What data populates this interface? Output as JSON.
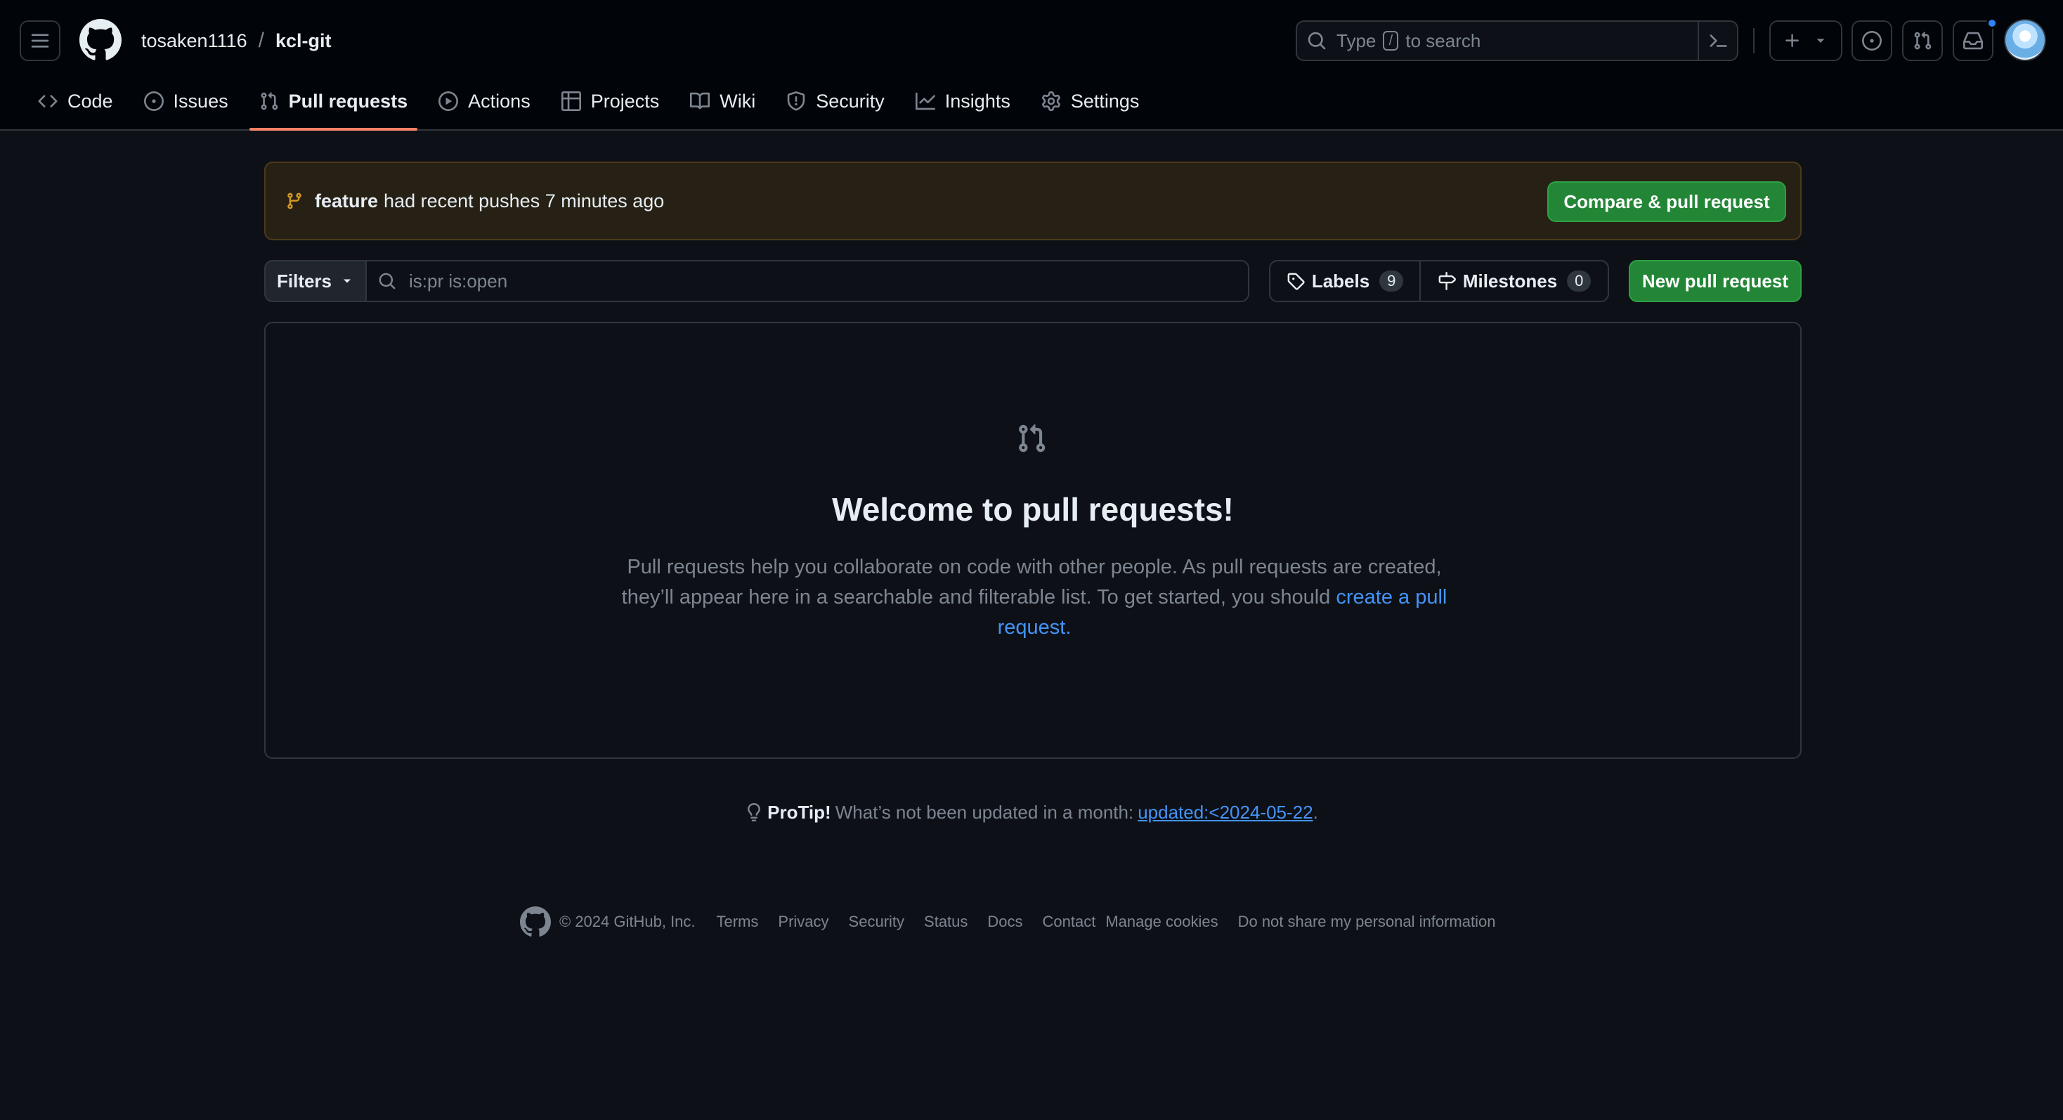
{
  "header": {
    "owner": "tosaken1116",
    "separator": "/",
    "repo": "kcl-git",
    "search": {
      "prefix": "Type",
      "key": "/",
      "suffix": "to search"
    }
  },
  "nav": {
    "tabs": [
      {
        "label": "Code",
        "icon": "code-icon"
      },
      {
        "label": "Issues",
        "icon": "issue-icon"
      },
      {
        "label": "Pull requests",
        "icon": "pull-request-icon",
        "active": true
      },
      {
        "label": "Actions",
        "icon": "play-icon"
      },
      {
        "label": "Projects",
        "icon": "table-icon"
      },
      {
        "label": "Wiki",
        "icon": "book-icon"
      },
      {
        "label": "Security",
        "icon": "shield-icon"
      },
      {
        "label": "Insights",
        "icon": "graph-icon"
      },
      {
        "label": "Settings",
        "icon": "gear-icon"
      }
    ]
  },
  "flash": {
    "branch": "feature",
    "message": "had recent pushes 7 minutes ago",
    "button": "Compare & pull request"
  },
  "filters": {
    "button": "Filters",
    "query": "is:pr is:open",
    "labels": {
      "label": "Labels",
      "count": "9"
    },
    "milestones": {
      "label": "Milestones",
      "count": "0"
    },
    "new_button": "New pull request"
  },
  "blankslate": {
    "title": "Welcome to pull requests!",
    "text": "Pull requests help you collaborate on code with other people. As pull requests are created, they’ll appear here in a searchable and filterable list. To get started, you should",
    "link": "create a pull request",
    "end": "."
  },
  "protip": {
    "label": "ProTip!",
    "text": "What’s not been updated in a month:",
    "link": "updated:<2024-05-22",
    "end": "."
  },
  "footer": {
    "copyright": "© 2024 GitHub, Inc.",
    "links": [
      "Terms",
      "Privacy",
      "Security",
      "Status",
      "Docs",
      "Contact",
      "Manage cookies",
      "Do not share my personal information"
    ]
  },
  "colors": {
    "background": "#0d1117",
    "header": "#010409",
    "accent_green": "#238636",
    "link_blue": "#4493f8",
    "active_tab_underline": "#f78166",
    "notification_dot": "#2f81f7"
  }
}
